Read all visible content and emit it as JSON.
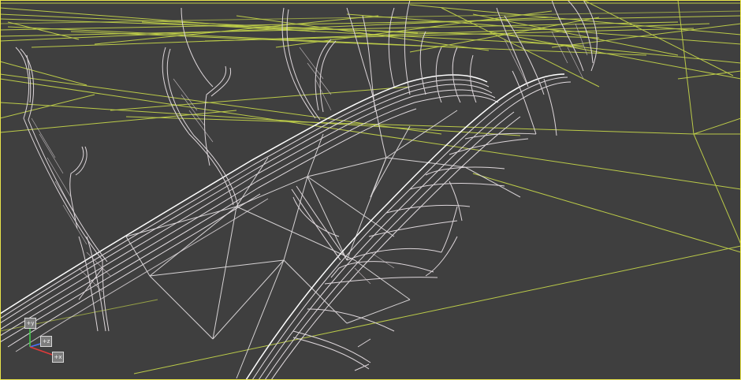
{
  "viewport": {
    "render_mode": "wireframe",
    "background_color": "#3f3f3f",
    "border_color": "#e8e34a"
  },
  "colors": {
    "terrain_wire": "#c9da4a",
    "object_wire": "#e2dce0",
    "object_wire_bright": "#ffffff",
    "axis_x": "#e03a3a",
    "axis_y": "#3fd04a",
    "axis_z": "#4a73ff"
  },
  "gizmo": {
    "icon": "axis-tripod-icon",
    "boxes": [
      {
        "label": "+y"
      },
      {
        "label": "+z"
      },
      {
        "label": "+x"
      }
    ]
  }
}
